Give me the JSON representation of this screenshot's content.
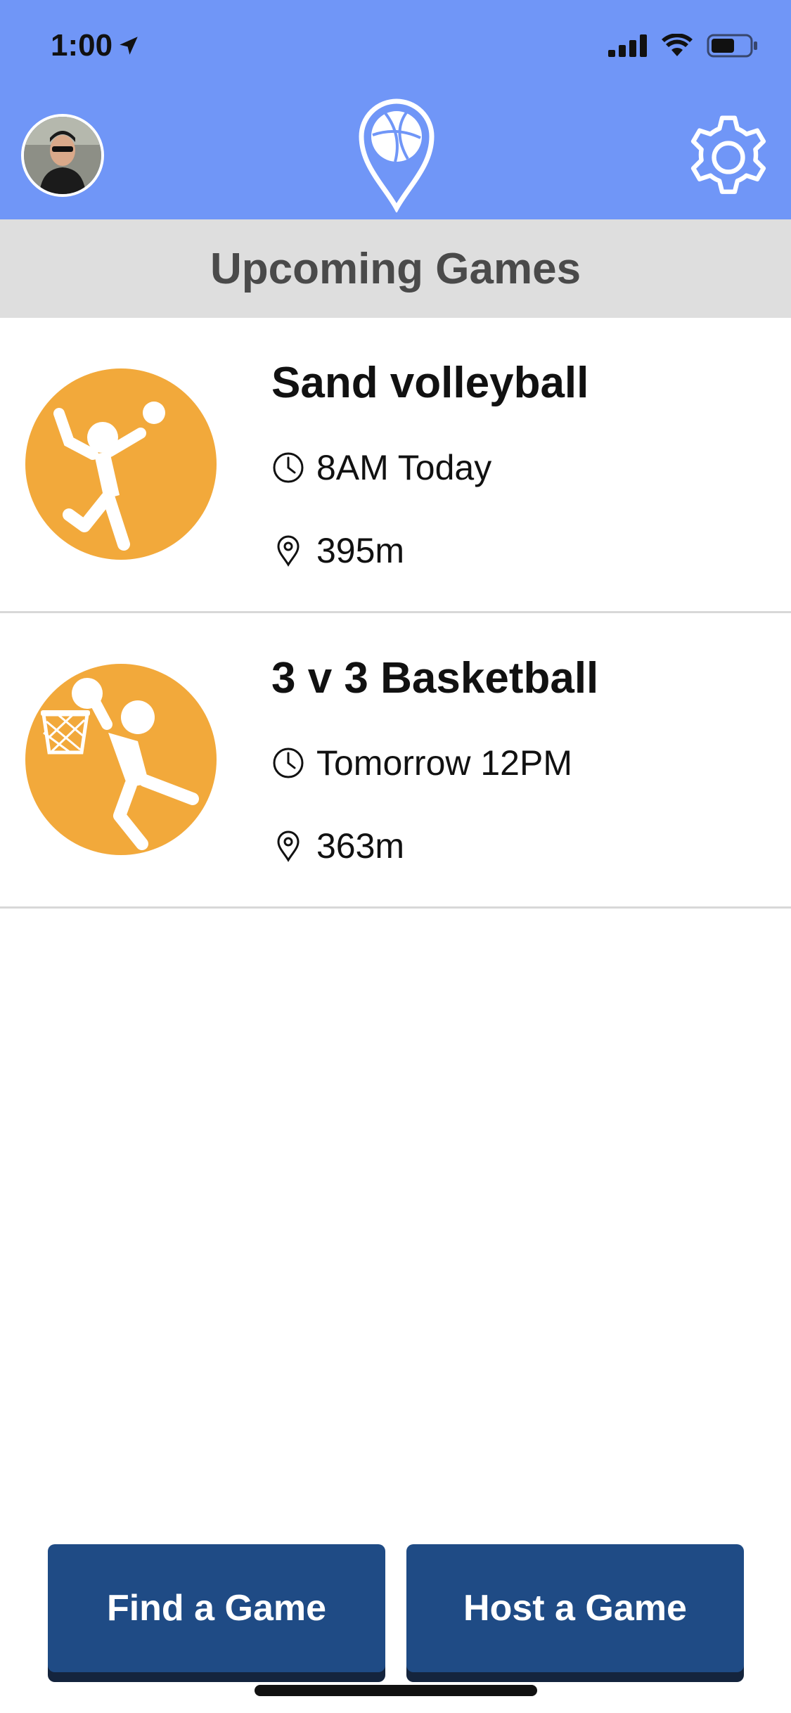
{
  "status_bar": {
    "time": "1:00"
  },
  "header": {
    "logo_icon": "basketball-pin-icon",
    "settings_icon": "gear-icon"
  },
  "section": {
    "title": "Upcoming Games"
  },
  "games": [
    {
      "title": "Sand volleyball",
      "time": "8AM Today",
      "distance": "395m",
      "icon": "volleyball-player-icon"
    },
    {
      "title": "3 v 3 Basketball",
      "time": "Tomorrow 12PM",
      "distance": "363m",
      "icon": "basketball-player-icon"
    }
  ],
  "buttons": {
    "find": "Find a Game",
    "host": "Host a Game"
  },
  "colors": {
    "header": "#7096f7",
    "accent": "#f2a93b",
    "button": "#1f4b85",
    "section_bar": "#dedede"
  }
}
